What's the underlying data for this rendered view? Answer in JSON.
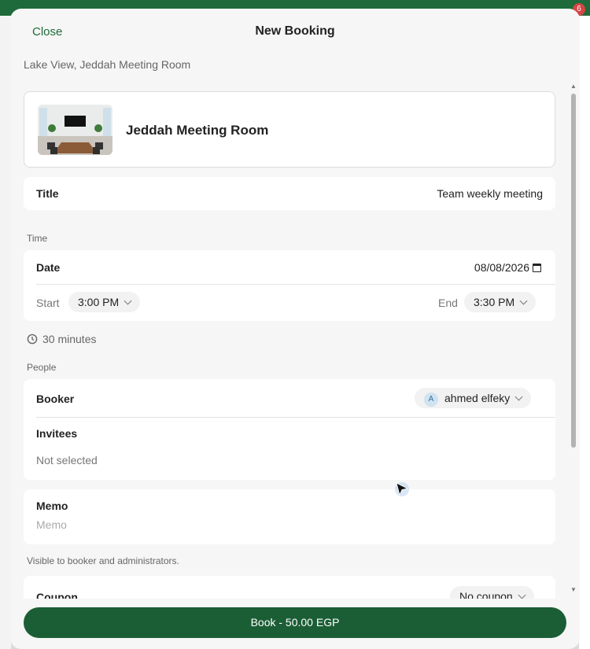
{
  "background": {
    "badge_count": "6"
  },
  "modal": {
    "close_label": "Close",
    "title": "New Booking",
    "location": "Lake View, Jeddah Meeting Room"
  },
  "room": {
    "name": "Jeddah Meeting Room"
  },
  "title_field": {
    "label": "Title",
    "value": "Team weekly meeting"
  },
  "time": {
    "section_label": "Time",
    "date_label": "Date",
    "date_value": "08/08/2026",
    "start_label": "Start",
    "start_value": "3:00 PM",
    "end_label": "End",
    "end_value": "3:30 PM",
    "duration": "30 minutes"
  },
  "people": {
    "section_label": "People",
    "booker_label": "Booker",
    "booker_initial": "A",
    "booker_name": "ahmed elfeky",
    "invitees_label": "Invitees",
    "invitees_value": "Not selected"
  },
  "memo": {
    "label": "Memo",
    "placeholder": "Memo",
    "hint": "Visible to booker and administrators."
  },
  "coupon": {
    "label": "Coupon",
    "value": "No coupon"
  },
  "book_button": {
    "label": "Book - 50.00 EGP"
  },
  "colors": {
    "accent": "#1b5e36",
    "topbar": "#1f6a3a"
  }
}
